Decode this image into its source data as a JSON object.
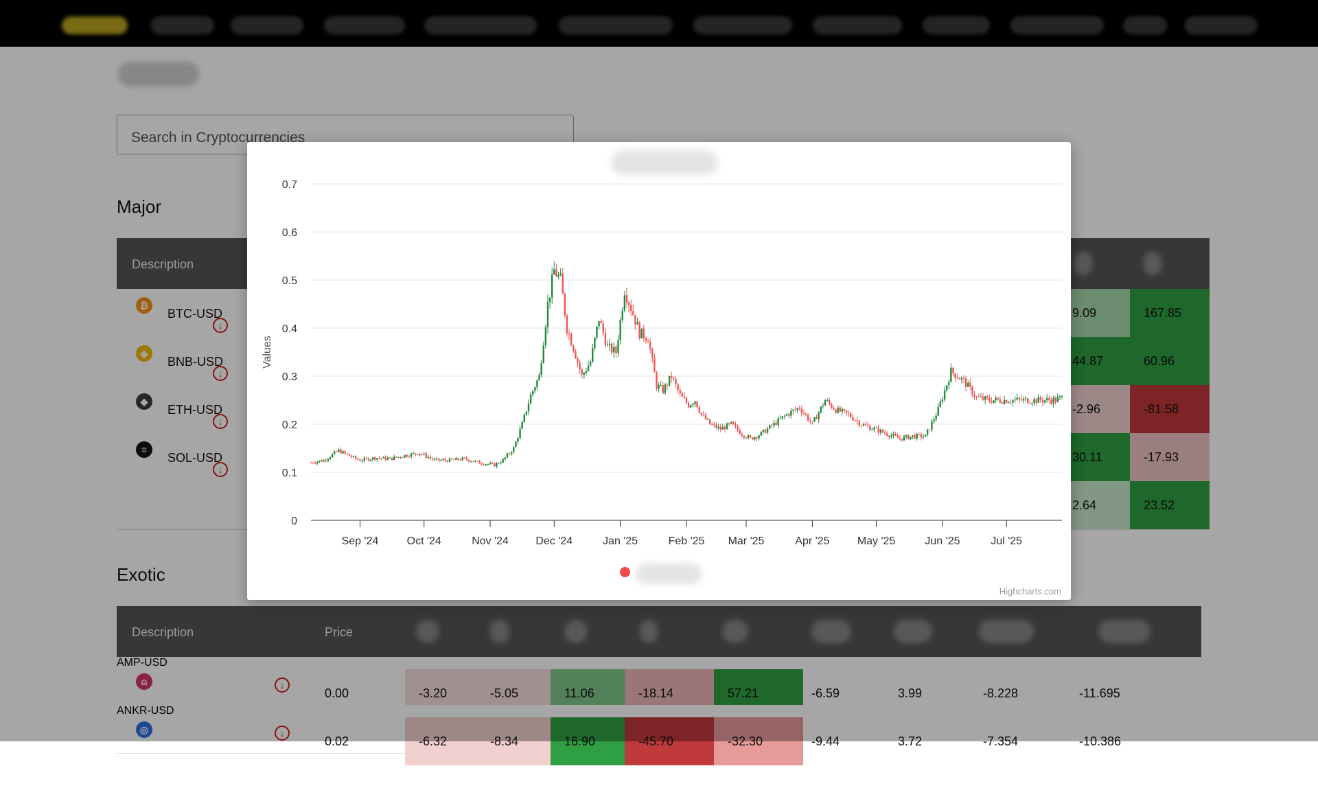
{
  "search": {
    "placeholder": "Search in Cryptocurrencies"
  },
  "sections": {
    "major": "Major",
    "exotic": "Exotic"
  },
  "major_table": {
    "header_description": "Description",
    "rows": [
      {
        "symbol": "BTC-USD",
        "icon": "bitcoin-icon",
        "icon_color": "#f7931a",
        "glyph": "₿",
        "col_a": "9.09",
        "col_b": "167.85",
        "col_a_bg": "#a6d8ad",
        "col_b_bg": "#2ea043"
      },
      {
        "symbol": "BNB-USD",
        "icon": "bnb-icon",
        "icon_color": "#f0b90b",
        "glyph": "◈",
        "col_a": "44.87",
        "col_b": "60.96",
        "col_a_bg": "#2ea043",
        "col_b_bg": "#2ea043"
      },
      {
        "symbol": "ETH-USD",
        "icon": "ethereum-icon",
        "icon_color": "#3c3c3d",
        "glyph": "◆",
        "col_a": "-2.96",
        "col_b": "-81.58",
        "col_a_bg": "#f2d2d2",
        "col_b_bg": "#c0393b"
      },
      {
        "symbol": "SOL-USD",
        "icon": "solana-icon",
        "icon_color": "#111111",
        "glyph": "≡",
        "col_a": "30.11",
        "col_b": "-17.93",
        "col_a_bg": "#2ea043",
        "col_b_bg": "#efc4c4"
      },
      {
        "symbol": "",
        "icon": "",
        "icon_color": "#ffffff",
        "glyph": "",
        "col_a": "2.64",
        "col_b": "23.52",
        "col_a_bg": "#c9e8cd",
        "col_b_bg": "#2ea043"
      }
    ]
  },
  "exotic_table": {
    "headers": {
      "description": "Description",
      "price": "Price"
    },
    "rows": [
      {
        "symbol": "AMP-USD",
        "icon": "amp-icon",
        "icon_color": "#d6336c",
        "glyph": "⍝",
        "price": "0.00",
        "v1": "-3.20",
        "v2": "-5.05",
        "v3": "11.06",
        "v4": "-18.14",
        "v5": "57.21",
        "v6": "-6.59",
        "v7": "3.99",
        "v8": "-8.228",
        "v9": "-11.695",
        "bg": [
          "#f6dede",
          "#f6dede",
          "#7fc78a",
          "#efb5b5",
          "#2ea043",
          "#ffffff",
          "#ffffff",
          "#ffffff",
          "#ffffff"
        ]
      },
      {
        "symbol": "ANKR-USD",
        "icon": "ankr-icon",
        "icon_color": "#2e6ee6",
        "glyph": "◎",
        "price": "0.02",
        "v1": "-6.32",
        "v2": "-8.34",
        "v3": "16.90",
        "v4": "-45.70",
        "v5": "-32.30",
        "v6": "-9.44",
        "v7": "3.72",
        "v8": "-7.354",
        "v9": "-10.386",
        "bg": [
          "#f2d0d0",
          "#f2d0d0",
          "#2ea043",
          "#c0393b",
          "#e79a9a",
          "#ffffff",
          "#ffffff",
          "#ffffff",
          "#ffffff"
        ]
      }
    ]
  },
  "chart_data": {
    "type": "candlestick",
    "title": "",
    "xlabel": "",
    "ylabel": "Values",
    "ylim": [
      0,
      0.7
    ],
    "yticks": [
      "0",
      "0.1",
      "0.2",
      "0.3",
      "0.4",
      "0.5",
      "0.6",
      "0.7"
    ],
    "xticks": [
      "Sep '24",
      "Oct '24",
      "Nov '24",
      "Dec '24",
      "Jan '25",
      "Feb '25",
      "Mar '25",
      "Apr '25",
      "May '25",
      "Jun '25",
      "Jul '25"
    ],
    "xtick_dates": [
      "2024-09-01",
      "2024-10-01",
      "2024-11-01",
      "2024-12-01",
      "2025-01-01",
      "2025-02-01",
      "2025-03-01",
      "2025-04-01",
      "2025-05-01",
      "2025-06-01",
      "2025-07-01"
    ],
    "x_range": [
      "2024-08-09",
      "2025-07-27"
    ],
    "up_color": "#1f8a3b",
    "down_color": "#f05454",
    "close_series_dates": [
      "2024-08-09",
      "2024-08-15",
      "2024-08-22",
      "2024-08-29",
      "2024-09-01",
      "2024-09-08",
      "2024-09-15",
      "2024-09-22",
      "2024-09-29",
      "2024-10-06",
      "2024-10-13",
      "2024-10-20",
      "2024-10-27",
      "2024-11-03",
      "2024-11-07",
      "2024-11-12",
      "2024-11-16",
      "2024-11-20",
      "2024-11-24",
      "2024-11-28",
      "2024-12-01",
      "2024-12-04",
      "2024-12-07",
      "2024-12-10",
      "2024-12-14",
      "2024-12-18",
      "2024-12-22",
      "2024-12-26",
      "2024-12-30",
      "2025-01-03",
      "2025-01-07",
      "2025-01-10",
      "2025-01-14",
      "2025-01-18",
      "2025-01-21",
      "2025-01-25",
      "2025-01-29",
      "2025-02-02",
      "2025-02-05",
      "2025-02-08",
      "2025-02-12",
      "2025-02-17",
      "2025-02-22",
      "2025-02-27",
      "2025-03-03",
      "2025-03-08",
      "2025-03-14",
      "2025-03-20",
      "2025-03-26",
      "2025-04-01",
      "2025-04-07",
      "2025-04-12",
      "2025-04-18",
      "2025-04-24",
      "2025-04-30",
      "2025-05-06",
      "2025-05-12",
      "2025-05-18",
      "2025-05-24",
      "2025-05-30",
      "2025-06-05",
      "2025-06-11",
      "2025-06-17",
      "2025-06-23",
      "2025-06-29",
      "2025-07-04",
      "2025-07-08",
      "2025-07-12",
      "2025-07-16",
      "2025-07-20",
      "2025-07-24",
      "2025-07-27"
    ],
    "close_series_values": [
      0.12,
      0.125,
      0.145,
      0.13,
      0.125,
      0.13,
      0.128,
      0.135,
      0.14,
      0.125,
      0.125,
      0.128,
      0.12,
      0.115,
      0.125,
      0.15,
      0.2,
      0.26,
      0.3,
      0.45,
      0.52,
      0.5,
      0.4,
      0.36,
      0.3,
      0.33,
      0.42,
      0.36,
      0.35,
      0.48,
      0.43,
      0.39,
      0.38,
      0.28,
      0.27,
      0.3,
      0.26,
      0.24,
      0.25,
      0.22,
      0.2,
      0.19,
      0.2,
      0.18,
      0.17,
      0.18,
      0.2,
      0.22,
      0.235,
      0.2,
      0.25,
      0.23,
      0.22,
      0.2,
      0.19,
      0.18,
      0.17,
      0.175,
      0.175,
      0.23,
      0.31,
      0.29,
      0.255,
      0.25,
      0.25,
      0.25,
      0.25,
      0.25,
      0.25,
      0.25,
      0.25,
      0.255
    ],
    "credits": "Highcharts.com"
  }
}
